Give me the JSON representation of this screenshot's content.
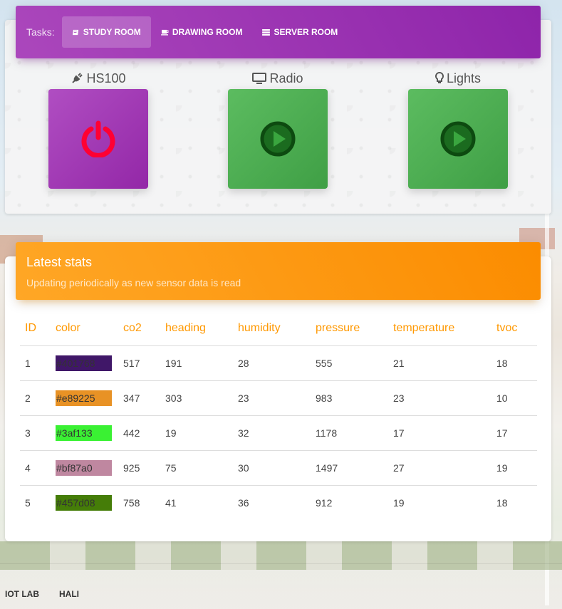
{
  "tasks": {
    "label": "Tasks:",
    "tabs": [
      {
        "label": "STUDY ROOM",
        "icon": "book-icon",
        "active": true
      },
      {
        "label": "DRAWING ROOM",
        "icon": "coffee-icon",
        "active": false
      },
      {
        "label": "SERVER ROOM",
        "icon": "server-icon",
        "active": false
      }
    ]
  },
  "devices": [
    {
      "name": "HS100",
      "icon": "plug-icon",
      "action_icon": "power-icon",
      "color": "#9c27b0"
    },
    {
      "name": "Radio",
      "icon": "monitor-icon",
      "action_icon": "play-icon",
      "color": "#4caf50"
    },
    {
      "name": "Lights",
      "icon": "lightbulb-icon",
      "action_icon": "play-icon",
      "color": "#4caf50"
    }
  ],
  "stats": {
    "title": "Latest stats",
    "subtitle": "Updating periodically as new sensor data is read",
    "columns": [
      "ID",
      "color",
      "co2",
      "heading",
      "humidity",
      "pressure",
      "temperature",
      "tvoc"
    ],
    "rows": [
      {
        "id": "1",
        "color": "#401768",
        "co2": "517",
        "heading": "191",
        "humidity": "28",
        "pressure": "555",
        "temperature": "21",
        "tvoc": "18"
      },
      {
        "id": "2",
        "color": "#e89225",
        "co2": "347",
        "heading": "303",
        "humidity": "23",
        "pressure": "983",
        "temperature": "23",
        "tvoc": "10"
      },
      {
        "id": "3",
        "color": "#3af133",
        "co2": "442",
        "heading": "19",
        "humidity": "32",
        "pressure": "1178",
        "temperature": "17",
        "tvoc": "17"
      },
      {
        "id": "4",
        "color": "#bf87a0",
        "co2": "925",
        "heading": "75",
        "humidity": "30",
        "pressure": "1497",
        "temperature": "27",
        "tvoc": "19"
      },
      {
        "id": "5",
        "color": "#457d08",
        "co2": "758",
        "heading": "41",
        "humidity": "36",
        "pressure": "912",
        "temperature": "19",
        "tvoc": "18"
      }
    ]
  },
  "footer": {
    "links": [
      "IOT LAB",
      "HALI"
    ]
  }
}
